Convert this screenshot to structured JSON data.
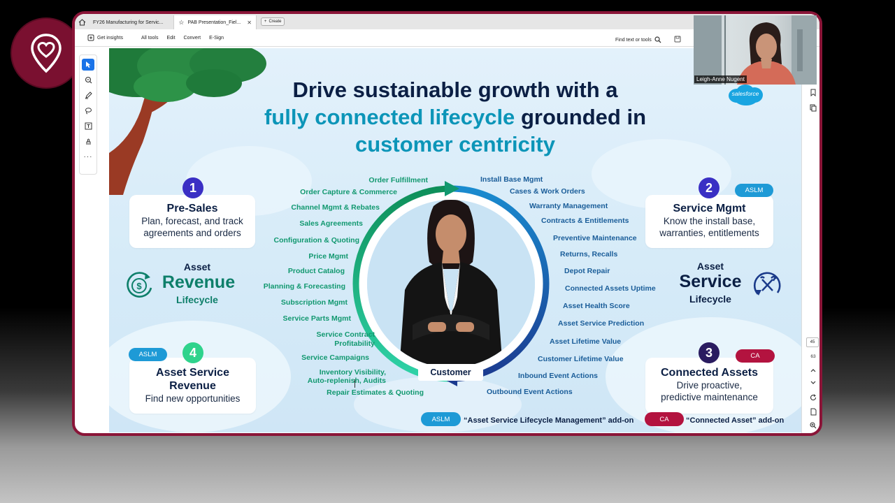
{
  "browser": {
    "tabs": [
      {
        "label": "FY26 Manufacturing for Servic...",
        "active": false
      },
      {
        "label": "PAB Presentation_Fiel...",
        "active": true
      }
    ],
    "new_tab_label": "Create"
  },
  "toolbar": {
    "get_insights": "Get insights",
    "items": [
      "All tools",
      "Edit",
      "Convert",
      "E-Sign"
    ],
    "find_text": "Find text or tools"
  },
  "pagination": {
    "current": "45",
    "total": "63"
  },
  "webcam": {
    "name": "Leigh-Anne Nugent"
  },
  "slide": {
    "brand": "salesforce",
    "title_line1": "Drive sustainable growth with a",
    "title_line2_teal": "fully connected lifecycle",
    "title_line2_dark": "grounded in",
    "title_line3": "customer centricity",
    "cards": {
      "presales": {
        "num": "1",
        "title": "Pre-Sales",
        "sub1": "Plan, forecast, and track",
        "sub2": "agreements and orders"
      },
      "servicemgmt": {
        "num": "2",
        "badge": "ASLM",
        "title": "Service Mgmt",
        "sub1": "Know the install base,",
        "sub2": "warranties, entitlements"
      },
      "connected": {
        "num": "3",
        "badge": "CA",
        "title": "Connected Assets",
        "sub1": "Drive proactive,",
        "sub2": "predictive maintenance"
      },
      "asr": {
        "num": "4",
        "badge": "ASLM",
        "title1": "Asset Service",
        "title2": "Revenue",
        "sub1": "Find new opportunities"
      }
    },
    "revenue_lifecycle": {
      "top": "Asset",
      "mid": "Revenue",
      "bot": "Lifecycle"
    },
    "service_lifecycle": {
      "top": "Asset",
      "mid": "Service",
      "bot": "Lifecycle"
    },
    "customer_label": "Customer",
    "left_items": [
      "Order Fulfillment",
      "Order Capture & Commerce",
      "Channel Mgmt & Rebates",
      "Sales Agreements",
      "Configuration & Quoting",
      "Price Mgmt",
      "Product Catalog",
      "Planning & Forecasting",
      "Subscription Mgmt",
      "Service Parts Mgmt",
      "Service Contract",
      "Profitability",
      "Service Campaigns",
      "Inventory Visibility,",
      "Auto-replenish, Audits",
      "Repair Estimates & Quoting"
    ],
    "right_items": [
      "Install Base Mgmt",
      "Cases & Work Orders",
      "Warranty Management",
      "Contracts & Entitlements",
      "Preventive Maintenance",
      "Returns, Recalls",
      "Depot Repair",
      "Connected Assets Uptime",
      "Asset Health Score",
      "Asset Service Prediction",
      "Asset Lifetime Value",
      "Customer Lifetime Value",
      "Inbound Event Actions",
      "Outbound Event Actions"
    ],
    "legend": {
      "aslm_badge": "ASLM",
      "aslm_text": "“Asset Service Lifecycle Management” add-on",
      "ca_badge": "CA",
      "ca_text": "“Connected Asset” add-on"
    }
  },
  "colors": {
    "frame": "#8a1538",
    "dark_navy": "#0b1f44",
    "teal": "#0c95b8",
    "green_label": "#11986f",
    "blue_label": "#1a5d99",
    "aslm_pill": "#1e9ad6",
    "ca_pill": "#b3133f"
  }
}
